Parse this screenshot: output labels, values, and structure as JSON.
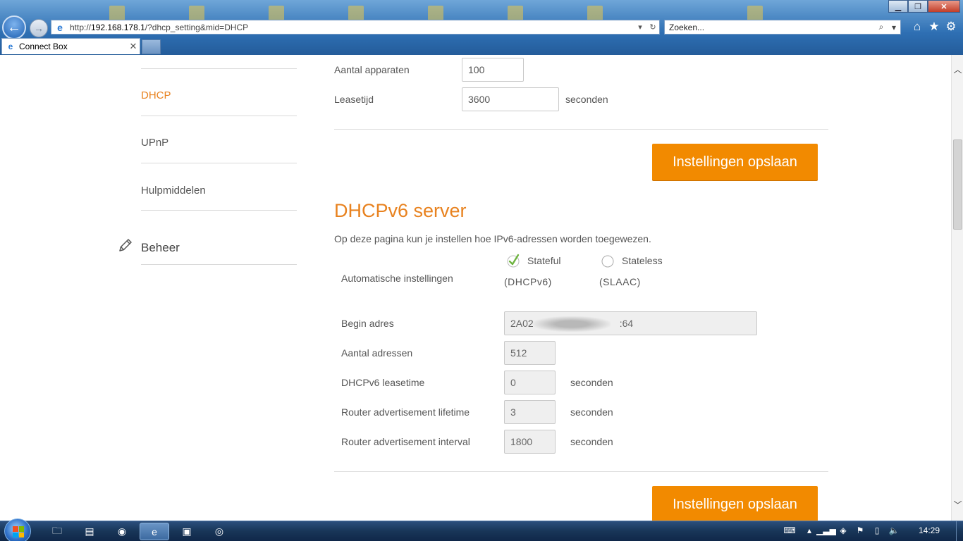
{
  "browser": {
    "url_prefix": "http://",
    "url_host": "192.168.178.1",
    "url_path": "/?dhcp_setting&mid=DHCP",
    "search_placeholder": "Zoeken...",
    "tab_title": "Connect Box",
    "tab_close": "✕"
  },
  "sidebar": {
    "items": [
      {
        "label": "DHCP",
        "active": true
      },
      {
        "label": "UPnP",
        "active": false
      },
      {
        "label": "Hulpmiddelen",
        "active": false
      }
    ],
    "section": "Beheer"
  },
  "dhcp": {
    "device_count_label": "Aantal apparaten",
    "device_count_value": "100",
    "lease_label": "Leasetijd",
    "lease_value": "3600",
    "lease_unit": "seconden",
    "save_label": "Instellingen opslaan"
  },
  "dhcpv6": {
    "title": "DHCPv6 server",
    "description": "Op deze pagina kun je instellen hoe IPv6-adressen worden toegewezen.",
    "auto_label": "Automatische instellingen",
    "opt_stateful": "Stateful",
    "opt_stateful_sub": "(DHCPv6)",
    "opt_stateless": "Stateless",
    "opt_stateless_sub": "(SLAAC)",
    "selected": "Stateful",
    "begin_label": "Begin adres",
    "begin_value_start": "2A02",
    "begin_value_end": ":64",
    "count_label": "Aantal adressen",
    "count_value": "512",
    "leasetime_label": "DHCPv6 leasetime",
    "leasetime_value": "0",
    "ra_lifetime_label": "Router advertisement lifetime",
    "ra_lifetime_value": "3",
    "ra_interval_label": "Router advertisement interval",
    "ra_interval_value": "1800",
    "unit": "seconden",
    "save_label": "Instellingen opslaan"
  },
  "taskbar": {
    "clock": "14:29"
  },
  "colors": {
    "accent": "#e8821f",
    "button": "#f28a00"
  }
}
